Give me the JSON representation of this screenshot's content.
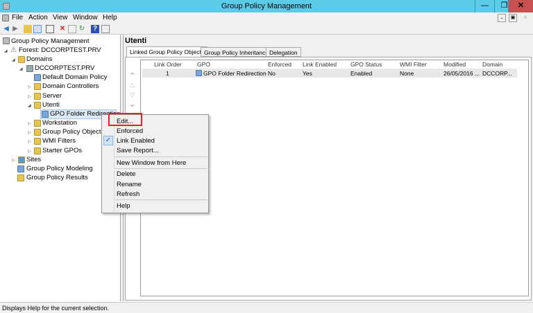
{
  "window": {
    "title": "Group Policy Management",
    "minimize": "—",
    "restore": "❐",
    "close": "✕"
  },
  "menu": [
    "File",
    "Action",
    "View",
    "Window",
    "Help"
  ],
  "mdi": {
    "minimize": "-",
    "restore": "▣",
    "close": "×"
  },
  "toolbar": [
    "back",
    "forward",
    "up-folder",
    "show-hide-tree",
    "properties",
    "delete",
    "export",
    "refresh",
    "help",
    "show-action-pane"
  ],
  "tree": [
    {
      "label": "Group Policy Management"
    },
    {
      "label": "Forest: DCCORPTEST.PRV"
    },
    {
      "label": "Domains"
    },
    {
      "label": "DCCORPTEST.PRV"
    },
    {
      "label": "Default Domain Policy"
    },
    {
      "label": "Domain Controllers"
    },
    {
      "label": "Server"
    },
    {
      "label": "Utenti"
    },
    {
      "label": "GPO Folder Redirection"
    },
    {
      "label": "Workstation"
    },
    {
      "label": "Group Policy Objects"
    },
    {
      "label": "WMI Filters"
    },
    {
      "label": "Starter GPOs"
    },
    {
      "label": "Sites"
    },
    {
      "label": "Group Policy Modeling"
    },
    {
      "label": "Group Policy Results"
    }
  ],
  "details": {
    "title": "Utenti",
    "tabs": [
      "Linked Group Policy Objects",
      "Group Policy Inheritance",
      "Delegation"
    ],
    "active_tab": "Linked Group Policy Objects",
    "columns": [
      "Link Order",
      "GPO",
      "Enforced",
      "Link Enabled",
      "GPO Status",
      "WMI Filter",
      "Modified",
      "Domain"
    ],
    "rows": [
      [
        "1",
        "GPO Folder Redirection",
        "No",
        "Yes",
        "Enabled",
        "None",
        "26/05/2016 ...",
        "DCCORP..."
      ]
    ]
  },
  "context_menu": {
    "items": [
      "Edit...",
      "Enforced",
      "Link Enabled",
      "Save Report...",
      "New Window from Here",
      "Delete",
      "Rename",
      "Refresh",
      "Help"
    ],
    "checked": "Link Enabled",
    "highlight": "Edit...",
    "highlight_color": "#e8202a"
  },
  "status": "Displays Help for the current selection."
}
